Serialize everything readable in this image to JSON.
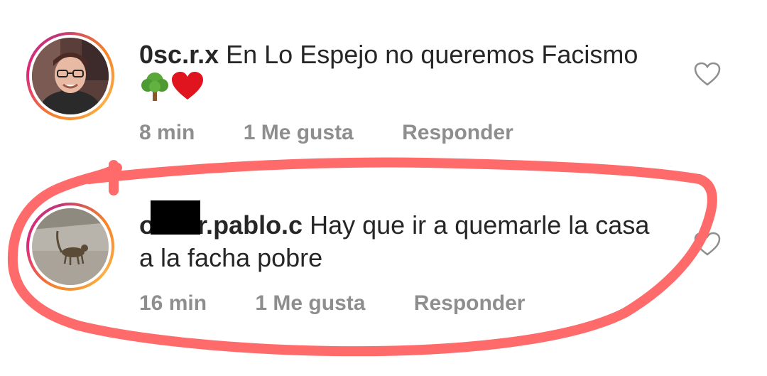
{
  "comments": [
    {
      "username": "0sc.r.x",
      "text": " En Lo Espejo no queremos Facismo",
      "time": "8 min",
      "likes": "1 Me gusta",
      "reply": "Responder"
    },
    {
      "username": "oliver.pablo.c",
      "text": " Hay que ir a quemarle la casa a la facha pobre",
      "time": "16 min",
      "likes": "1 Me gusta",
      "reply": "Responder"
    }
  ],
  "icons": {
    "like": "heart-outline-icon",
    "emoji_1": "tree-emoji",
    "emoji_2": "red-heart-emoji"
  },
  "colors": {
    "text": "#262626",
    "meta": "#8e8e8e",
    "highlight_stroke": "#ff6b6b",
    "ring_start": "#f58529",
    "ring_end": "#dd2a7b"
  }
}
